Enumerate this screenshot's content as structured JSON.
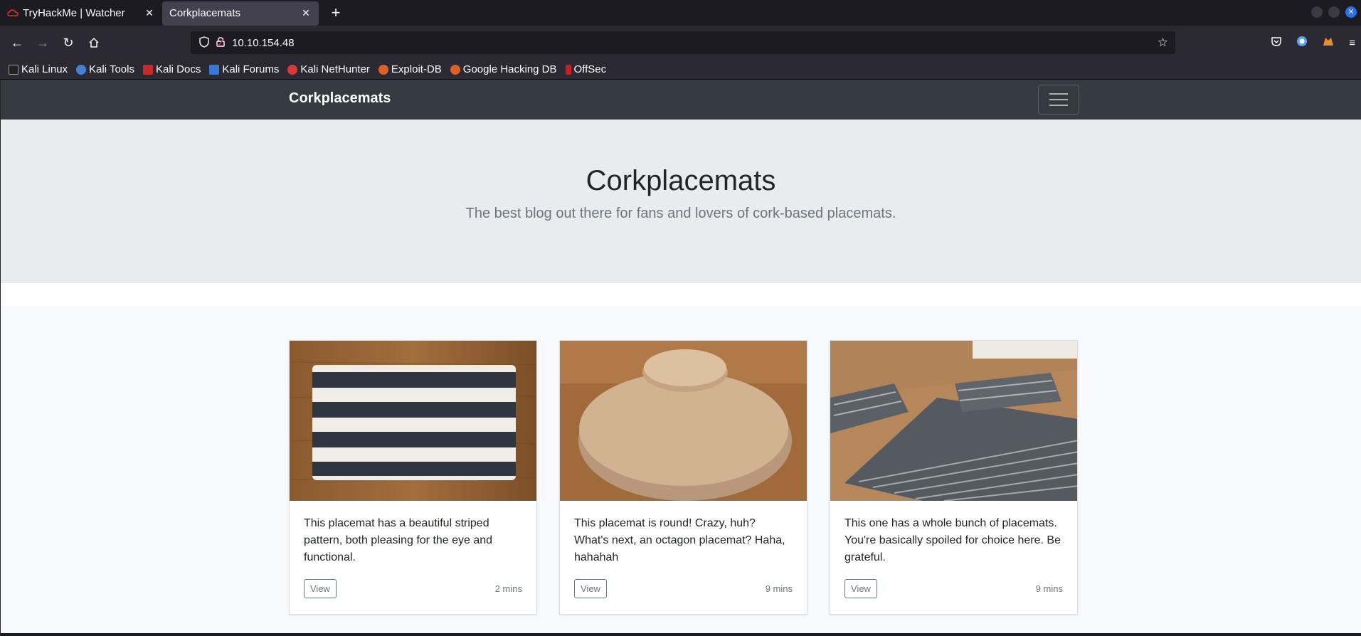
{
  "browser": {
    "tabs": [
      {
        "title": "TryHackMe | Watcher",
        "active": false
      },
      {
        "title": "Corkplacemats",
        "active": true
      }
    ],
    "url": "10.10.154.48",
    "bookmarks": [
      "Kali Linux",
      "Kali Tools",
      "Kali Docs",
      "Kali Forums",
      "Kali NetHunter",
      "Exploit-DB",
      "Google Hacking DB",
      "OffSec"
    ]
  },
  "site": {
    "brand": "Corkplacemats",
    "heading": "Corkplacemats",
    "lead": "The best blog out there for fans and lovers of cork-based placemats.",
    "cards": [
      {
        "text": "This placemat has a beautiful striped pattern, both pleasing for the eye and functional.",
        "button": "View",
        "time": "2 mins"
      },
      {
        "text": "This placemat is round! Crazy, huh? What's next, an octagon placemat? Haha, hahahah",
        "button": "View",
        "time": "9 mins"
      },
      {
        "text": "This one has a whole bunch of placemats. You're basically spoiled for choice here. Be grateful.",
        "button": "View",
        "time": "9 mins"
      }
    ]
  },
  "colors": {
    "navbar": "#343a40",
    "jumbotron": "#e9ecef",
    "browser_bg": "#1c1b22"
  }
}
